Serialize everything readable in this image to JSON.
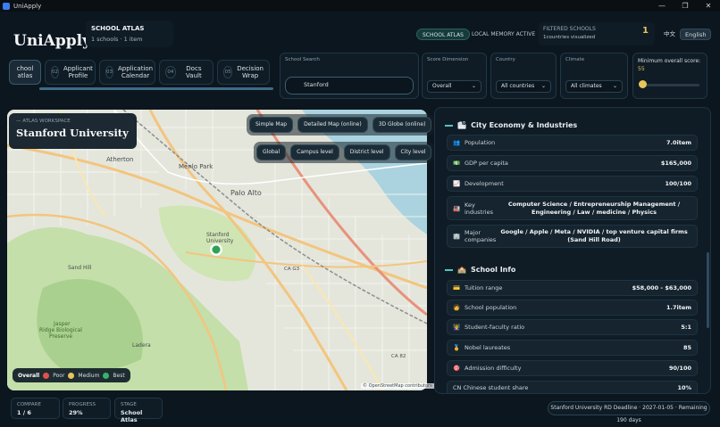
{
  "window": {
    "title": "UniApply",
    "min": "—",
    "max": "❐",
    "close": "✕"
  },
  "brand": {
    "logo": "UniApply",
    "section": "SCHOOL ATLAS",
    "count": "1 schools · 1 item"
  },
  "header": {
    "pill_atlas": "SCHOOL ATLAS",
    "pill_memory": "LOCAL MEMORY ACTIVE",
    "filtered_title": "FILTERED SCHOOLS",
    "filtered_sub": "1countries visualized",
    "filtered_count": "1",
    "lang_zh": "中文",
    "lang_en": "English"
  },
  "steps": [
    {
      "num": "",
      "label": "chool\natlas"
    },
    {
      "num": "02",
      "label": "Applicant\nProfile"
    },
    {
      "num": "03",
      "label": "Application\nCalendar"
    },
    {
      "num": "04",
      "label": "Docs Vault"
    },
    {
      "num": "05",
      "label": "Decision\nWrap"
    }
  ],
  "filters": {
    "search_label": "School Search",
    "search_value": "Stanford",
    "score_label": "Score Dimension",
    "score_value": "Overall",
    "country_label": "Country",
    "country_value": "All countries",
    "climate_label": "Climate",
    "climate_value": "All climates",
    "min_label": "Minimum overall score:",
    "min_value": "55",
    "min_fraction": 0.05
  },
  "map": {
    "workspace": "ATLAS WORKSPACE",
    "school": "Stanford University",
    "btn_simple": "Simple Map",
    "btn_detailed": "Detailed Map (online)",
    "btn_globe": "3D Globe (online)",
    "btn_global": "Global",
    "btn_campus": "Campus level",
    "btn_district": "District level",
    "btn_city": "City level",
    "places": {
      "atherton": "Atherton",
      "menlo": "Menlo Park",
      "palo": "Palo Alto",
      "stanford": "Stanford\nUniversity",
      "sandhill": "Sand Hill",
      "jasper": "Jasper\nRidge Biological\nPreserve",
      "ladera": "Ladera",
      "cag3": "CA G3",
      "ca82": "CA 82"
    },
    "attribution": "© OpenStreetMap contributors",
    "legend": {
      "title": "Overall",
      "poor": "Poor",
      "medium": "Medium",
      "best": "Best"
    },
    "colors": {
      "poor": "#e0524b",
      "medium": "#e8c45a",
      "best": "#35b36b",
      "marker": "#2ea05a"
    }
  },
  "economy": {
    "title": "City Economy & Industries",
    "rows": [
      {
        "icon": "👥",
        "label": "Population",
        "value": "7.0item"
      },
      {
        "icon": "💵",
        "label": "GDP per capita",
        "value": "$165,000"
      },
      {
        "icon": "📈",
        "label": "Development",
        "value": "100/100"
      },
      {
        "icon": "🏭",
        "label": "Key\nindustries",
        "value": "Computer Science / Entrepreneurship Management / Engineering / Law / medicine / Physics"
      },
      {
        "icon": "🏢",
        "label": "Major\ncompanies",
        "value": "Google / Apple / Meta / NVIDIA / top venture capital firms (Sand Hill Road)"
      }
    ]
  },
  "school_info": {
    "title": "School Info",
    "rows": [
      {
        "icon": "💳",
        "label": "Tuition range",
        "value": "$58,000 - $63,000"
      },
      {
        "icon": "🧑",
        "label": "School population",
        "value": "1.7item"
      },
      {
        "icon": "👩‍🏫",
        "label": "Student-faculty ratio",
        "value": "5:1"
      },
      {
        "icon": "🏅",
        "label": "Nobel laureates",
        "value": "85"
      },
      {
        "icon": "🎯",
        "label": "Admission difficulty",
        "value": "90/100"
      },
      {
        "icon": "",
        "label": "CN Chinese student share",
        "value": "10%"
      }
    ]
  },
  "footer": {
    "compare_label": "COMPARE",
    "compare_value": "1 / 6",
    "progress_label": "PROGRESS",
    "progress_value": "29%",
    "stage_label": "STAGE",
    "stage_value": "School Atlas",
    "deadline": "Stanford University RD Deadline · 2027-01-05 · Remaining 190 days"
  }
}
